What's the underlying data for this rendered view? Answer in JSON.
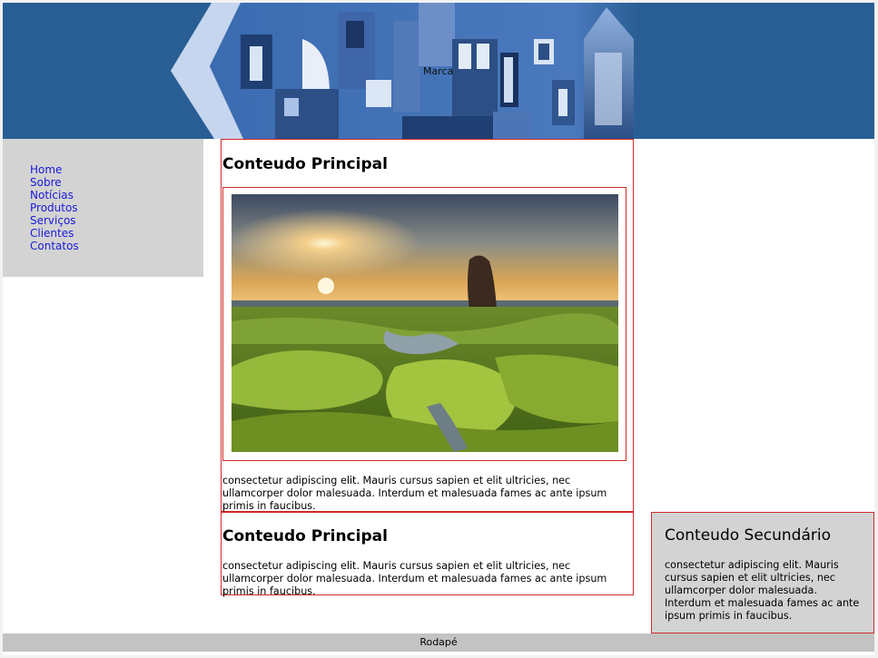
{
  "header": {
    "brand": "Marca"
  },
  "nav": {
    "items": [
      {
        "label": "Home"
      },
      {
        "label": "Sobre"
      },
      {
        "label": "Notícias"
      },
      {
        "label": "Produtos"
      },
      {
        "label": "Serviços"
      },
      {
        "label": "Clientes"
      },
      {
        "label": "Contatos"
      }
    ]
  },
  "main": {
    "sections": [
      {
        "title": "Conteudo Principal",
        "text": "consectetur adipiscing elit. Mauris cursus sapien et elit ultricies, nec ullamcorper dolor malesuada. Interdum et malesuada fames ac ante ipsum primis in faucibus."
      },
      {
        "title": "Conteudo Principal",
        "text": "consectetur adipiscing elit. Mauris cursus sapien et elit ultricies, nec ullamcorper dolor malesuada. Interdum et malesuada fames ac ante ipsum primis in faucibus."
      }
    ]
  },
  "secondary": {
    "title": "Conteudo Secundário",
    "text": "consectetur adipiscing elit. Mauris cursus sapien et elit ultricies, nec ullamcorper dolor malesuada. Interdum et malesuada fames ac ante ipsum primis in faucibus."
  },
  "footer": {
    "text": "Rodapé"
  },
  "colors": {
    "header_bg": "#295e94",
    "sidebar_bg": "#d3d3d3",
    "border": "#d12a2a",
    "link": "#1a1ad6",
    "footer_bg": "#c3c3c3"
  }
}
